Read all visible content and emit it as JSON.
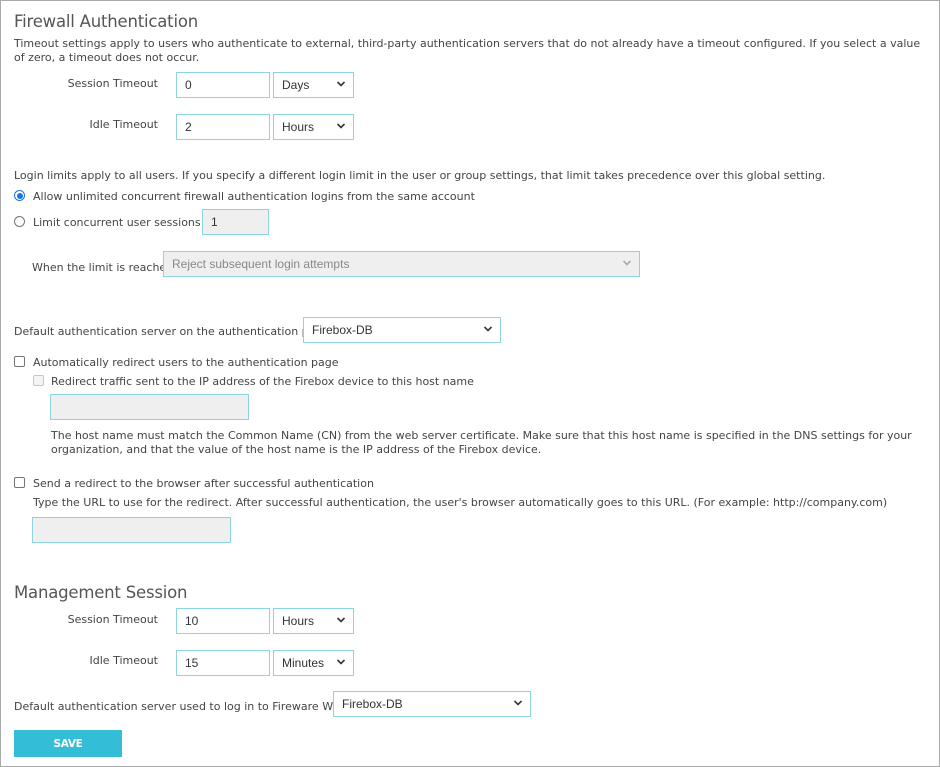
{
  "firewall_auth": {
    "title": "Firewall Authentication",
    "intro": "Timeout settings apply to users who authenticate to external, third-party authentication servers that do not already have a timeout configured. If you select a value of zero, a timeout does not occur.",
    "session_timeout": {
      "label": "Session Timeout",
      "value": "0",
      "unit": "Days"
    },
    "idle_timeout": {
      "label": "Idle Timeout",
      "value": "2",
      "unit": "Hours"
    },
    "login_limits_text": "Login limits apply to all users. If you specify a different login limit in the user or group settings, that limit takes precedence over this global setting.",
    "radio_unlimited": {
      "label": "Allow unlimited concurrent firewall authentication logins from the same account",
      "checked": true
    },
    "radio_limit": {
      "label": "Limit concurrent user sessions to",
      "checked": false,
      "value": "1"
    },
    "limit_reached": {
      "label": "When the limit is reached",
      "value": "Reject subsequent login attempts"
    },
    "default_server": {
      "label": "Default authentication server on the authentication page",
      "value": "Firebox-DB"
    },
    "auto_redirect": {
      "label": "Automatically redirect users to the authentication page",
      "checked": false
    },
    "redirect_traffic": {
      "label": "Redirect traffic sent to the IP address of the Firebox device to this host name",
      "checked": false,
      "value": ""
    },
    "host_note": "The host name must match the Common Name (CN) from the web server certificate. Make sure that this host name is specified in the DNS settings for your organization, and that the value of the host name is the IP address of the Firebox device.",
    "send_redirect": {
      "label": "Send a redirect to the browser after successful authentication",
      "checked": false
    },
    "redirect_note": "Type the URL to use for the redirect. After successful authentication, the user's browser automatically goes to this URL. (For example: http://company.com)",
    "redirect_url": ""
  },
  "management_session": {
    "title": "Management Session",
    "session_timeout": {
      "label": "Session Timeout",
      "value": "10",
      "unit": "Hours"
    },
    "idle_timeout": {
      "label": "Idle Timeout",
      "value": "15",
      "unit": "Minutes"
    },
    "default_server": {
      "label": "Default authentication server used to log in to Fireware Web UI",
      "value": "Firebox-DB"
    }
  },
  "actions": {
    "save_label": "SAVE"
  },
  "colors": {
    "accent": "#33bdd6",
    "input_border": "#8ed3e0",
    "radio_checked": "#1a73e8"
  }
}
